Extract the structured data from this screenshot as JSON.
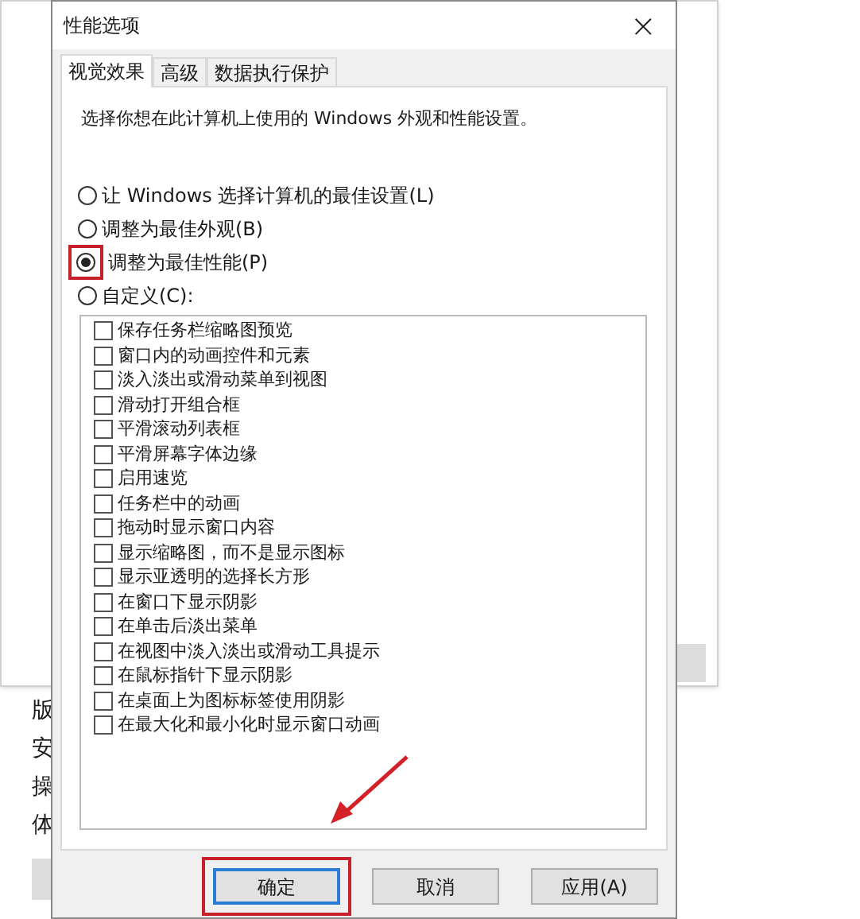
{
  "background_window": {
    "labels": [
      "版",
      "安",
      "操",
      "体"
    ]
  },
  "dialog": {
    "title": "性能选项",
    "close": "×"
  },
  "tabs": [
    {
      "label": "视觉效果",
      "selected": true
    },
    {
      "label": "高级",
      "selected": false
    },
    {
      "label": "数据执行保护",
      "selected": false
    }
  ],
  "description": "选择你想在此计算机上使用的 Windows 外观和性能设置。",
  "options": [
    {
      "label": "让 Windows 选择计算机的最佳设置(L)",
      "selected": false,
      "highlighted": false
    },
    {
      "label": "调整为最佳外观(B)",
      "selected": false,
      "highlighted": false
    },
    {
      "label": "调整为最佳性能(P)",
      "selected": true,
      "highlighted": true
    },
    {
      "label": "自定义(C):",
      "selected": false,
      "highlighted": false
    }
  ],
  "effects": [
    {
      "label": "保存任务栏缩略图预览",
      "checked": false
    },
    {
      "label": "窗口内的动画控件和元素",
      "checked": false
    },
    {
      "label": "淡入淡出或滑动菜单到视图",
      "checked": false
    },
    {
      "label": "滑动打开组合框",
      "checked": false
    },
    {
      "label": "平滑滚动列表框",
      "checked": false
    },
    {
      "label": "平滑屏幕字体边缘",
      "checked": false
    },
    {
      "label": "启用速览",
      "checked": false
    },
    {
      "label": "任务栏中的动画",
      "checked": false
    },
    {
      "label": "拖动时显示窗口内容",
      "checked": false
    },
    {
      "label": "显示缩略图，而不是显示图标",
      "checked": false
    },
    {
      "label": "显示亚透明的选择长方形",
      "checked": false
    },
    {
      "label": "在窗口下显示阴影",
      "checked": false
    },
    {
      "label": "在单击后淡出菜单",
      "checked": false
    },
    {
      "label": "在视图中淡入淡出或滑动工具提示",
      "checked": false
    },
    {
      "label": "在鼠标指针下显示阴影",
      "checked": false
    },
    {
      "label": "在桌面上为图标标签使用阴影",
      "checked": false
    },
    {
      "label": "在最大化和最小化时显示窗口动画",
      "checked": false
    }
  ],
  "buttons": [
    {
      "label": "确定",
      "default": true,
      "highlighted": true
    },
    {
      "label": "取消",
      "default": false,
      "highlighted": false
    },
    {
      "label": "应用(A)",
      "default": false,
      "highlighted": false
    }
  ]
}
